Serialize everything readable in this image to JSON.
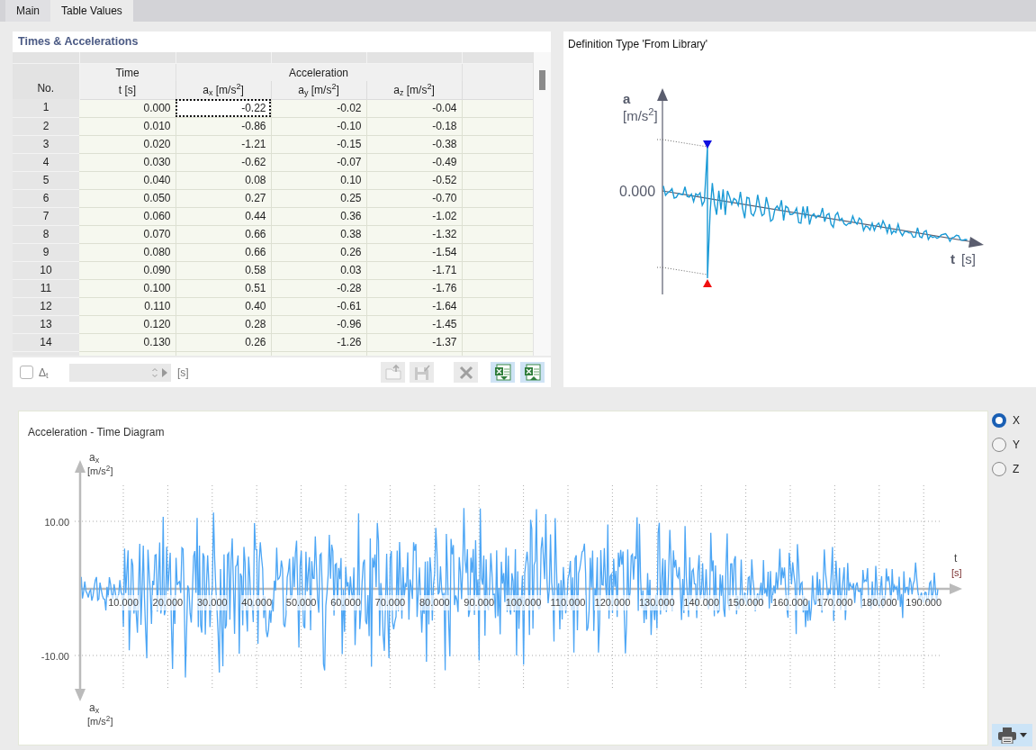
{
  "tabs": [
    {
      "label": "Main",
      "selected": false
    },
    {
      "label": "Table Values",
      "selected": true
    }
  ],
  "table": {
    "title": "Times & Accelerations",
    "header_groups": [
      "Time",
      "Acceleration"
    ],
    "columns": [
      "No.",
      "t [s]",
      "a$_{x}$ [m/s$^{2}$]",
      "a$_{y}$ [m/s$^{2}$]",
      "a$_{z}$ [m/s$^{2}$]"
    ],
    "rows": [
      {
        "cells": [
          {
            "text": "1",
            "focused": false
          },
          {
            "text": "0.000",
            "focused": false
          },
          {
            "text": "-0.22",
            "focused": true
          },
          {
            "text": "-0.02",
            "focused": false
          },
          {
            "text": "-0.04",
            "focused": false
          }
        ]
      },
      {
        "cells": [
          {
            "text": "2",
            "focused": false
          },
          {
            "text": "0.010",
            "focused": false
          },
          {
            "text": "-0.86",
            "focused": false
          },
          {
            "text": "-0.10",
            "focused": false
          },
          {
            "text": "-0.18",
            "focused": false
          }
        ]
      },
      {
        "cells": [
          {
            "text": "3",
            "focused": false
          },
          {
            "text": "0.020",
            "focused": false
          },
          {
            "text": "-1.21",
            "focused": false
          },
          {
            "text": "-0.15",
            "focused": false
          },
          {
            "text": "-0.38",
            "focused": false
          }
        ]
      },
      {
        "cells": [
          {
            "text": "4",
            "focused": false
          },
          {
            "text": "0.030",
            "focused": false
          },
          {
            "text": "-0.62",
            "focused": false
          },
          {
            "text": "-0.07",
            "focused": false
          },
          {
            "text": "-0.49",
            "focused": false
          }
        ]
      },
      {
        "cells": [
          {
            "text": "5",
            "focused": false
          },
          {
            "text": "0.040",
            "focused": false
          },
          {
            "text": "0.08",
            "focused": false
          },
          {
            "text": "0.10",
            "focused": false
          },
          {
            "text": "-0.52",
            "focused": false
          }
        ]
      },
      {
        "cells": [
          {
            "text": "6",
            "focused": false
          },
          {
            "text": "0.050",
            "focused": false
          },
          {
            "text": "0.27",
            "focused": false
          },
          {
            "text": "0.25",
            "focused": false
          },
          {
            "text": "-0.70",
            "focused": false
          }
        ]
      },
      {
        "cells": [
          {
            "text": "7",
            "focused": false
          },
          {
            "text": "0.060",
            "focused": false
          },
          {
            "text": "0.44",
            "focused": false
          },
          {
            "text": "0.36",
            "focused": false
          },
          {
            "text": "-1.02",
            "focused": false
          }
        ]
      },
      {
        "cells": [
          {
            "text": "8",
            "focused": false
          },
          {
            "text": "0.070",
            "focused": false
          },
          {
            "text": "0.66",
            "focused": false
          },
          {
            "text": "0.38",
            "focused": false
          },
          {
            "text": "-1.32",
            "focused": false
          }
        ]
      },
      {
        "cells": [
          {
            "text": "9",
            "focused": false
          },
          {
            "text": "0.080",
            "focused": false
          },
          {
            "text": "0.66",
            "focused": false
          },
          {
            "text": "0.26",
            "focused": false
          },
          {
            "text": "-1.54",
            "focused": false
          }
        ]
      },
      {
        "cells": [
          {
            "text": "10",
            "focused": false
          },
          {
            "text": "0.090",
            "focused": false
          },
          {
            "text": "0.58",
            "focused": false
          },
          {
            "text": "0.03",
            "focused": false
          },
          {
            "text": "-1.71",
            "focused": false
          }
        ]
      },
      {
        "cells": [
          {
            "text": "11",
            "focused": false
          },
          {
            "text": "0.100",
            "focused": false
          },
          {
            "text": "0.51",
            "focused": false
          },
          {
            "text": "-0.28",
            "focused": false
          },
          {
            "text": "-1.76",
            "focused": false
          }
        ]
      },
      {
        "cells": [
          {
            "text": "12",
            "focused": false
          },
          {
            "text": "0.110",
            "focused": false
          },
          {
            "text": "0.40",
            "focused": false
          },
          {
            "text": "-0.61",
            "focused": false
          },
          {
            "text": "-1.64",
            "focused": false
          }
        ]
      },
      {
        "cells": [
          {
            "text": "13",
            "focused": false
          },
          {
            "text": "0.120",
            "focused": false
          },
          {
            "text": "0.28",
            "focused": false
          },
          {
            "text": "-0.96",
            "focused": false
          },
          {
            "text": "-1.45",
            "focused": false
          }
        ]
      },
      {
        "cells": [
          {
            "text": "14",
            "focused": false
          },
          {
            "text": "0.130",
            "focused": false
          },
          {
            "text": "0.26",
            "focused": false
          },
          {
            "text": "-1.26",
            "focused": false
          },
          {
            "text": "-1.37",
            "focused": false
          }
        ]
      }
    ]
  },
  "table_toolbar": {
    "delta_t": {
      "label": "Δ$_{t}$",
      "checked": false
    },
    "step_field": {
      "unit": "[s]",
      "disabled": true
    },
    "buttons": [
      {
        "kind": "import",
        "disabled": true
      },
      {
        "kind": "save",
        "disabled": true
      },
      {
        "kind": "delete",
        "disabled": true
      },
      {
        "kind": "excel-export",
        "disabled": false
      },
      {
        "kind": "excel-import",
        "disabled": false
      }
    ]
  },
  "definition_diagram": {
    "title": "Definition Type 'From Library'",
    "y_label": "a",
    "y_unit": "[m/s$^{2}$]",
    "zero_label": "0.000",
    "x_label": "t",
    "x_unit": "[s]"
  },
  "time_diagram": {
    "title": "Acceleration - Time Diagram",
    "y_axis_top": {
      "label": "a$_{x}$",
      "unit": "[m/s$^{2}$]"
    },
    "y_axis_bottom": {
      "label": "a$_{x}$",
      "unit": "[m/s$^{2}$]"
    },
    "y_tick_labels": [
      "10.00",
      "-10.00"
    ],
    "x_tick_labels": [
      "10.000",
      "20.000",
      "30.000",
      "40.000",
      "50.000",
      "60.000",
      "70.000",
      "80.000",
      "90.000",
      "100.000",
      "110.000",
      "120.000",
      "130.000",
      "140.000",
      "150.000",
      "160.000",
      "170.000",
      "180.000",
      "190.000"
    ],
    "x_axis": {
      "label": "t",
      "unit": "[s]"
    }
  },
  "direction": [
    {
      "label": "X",
      "selected": true
    },
    {
      "label": "Y",
      "selected": false
    },
    {
      "label": "Z",
      "selected": false
    }
  ]
}
